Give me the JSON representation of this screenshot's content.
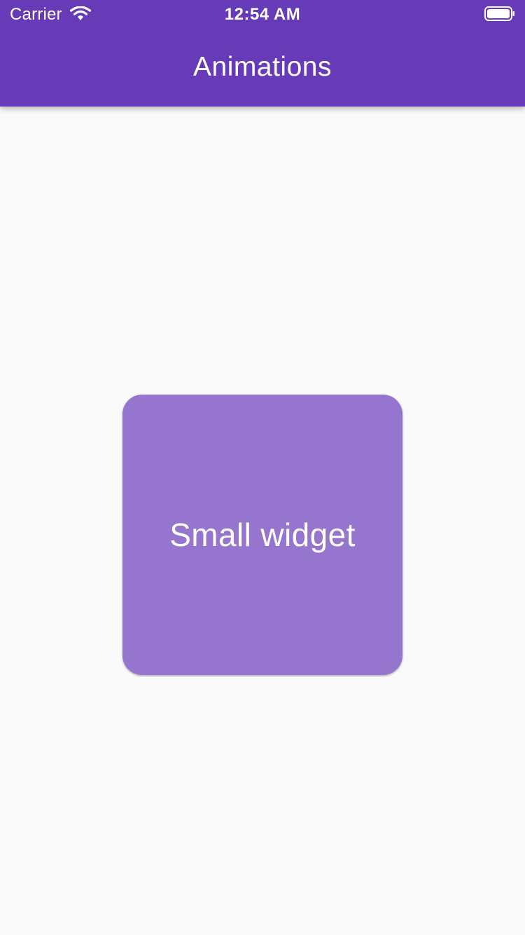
{
  "status_bar": {
    "carrier": "Carrier",
    "time": "12:54 AM",
    "wifi_icon": "wifi-icon",
    "battery_icon": "battery-icon"
  },
  "app_bar": {
    "title": "Animations",
    "background_color": "#673ab7"
  },
  "main": {
    "widget_label": "Small widget",
    "widget_color": "#9575cd"
  }
}
